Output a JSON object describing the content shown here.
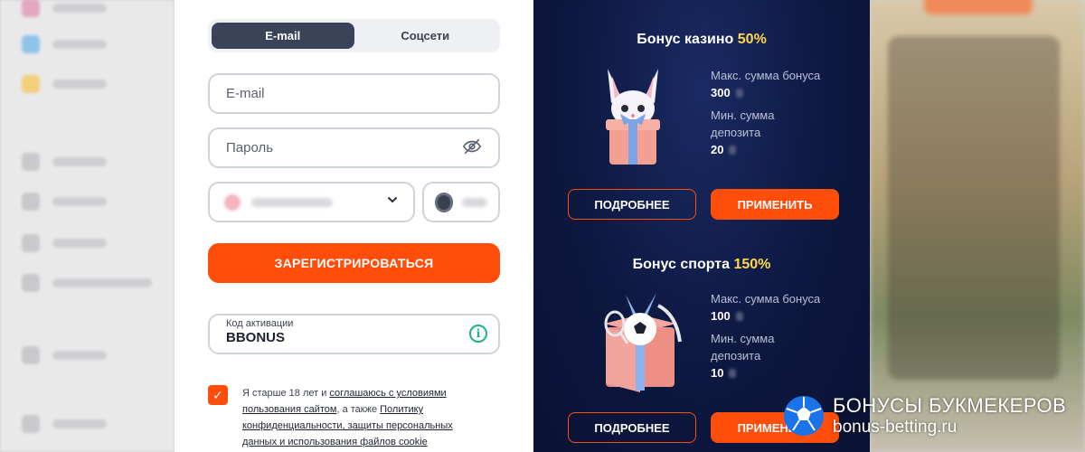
{
  "form": {
    "tabs": [
      {
        "label": "E-mail",
        "active": true
      },
      {
        "label": "Соцсети",
        "active": false
      }
    ],
    "email_placeholder": "E-mail",
    "password_placeholder": "Пароль",
    "register_label": "ЗАРЕГИСТРИРОВАТЬСЯ",
    "promo_label": "Код активации",
    "promo_value": "BBONUS",
    "agree": {
      "t1": "Я старше 18 лет и ",
      "l1": "соглашаюсь с условиями пользования сайтом",
      "t2": ", а также ",
      "l2": "Политику конфиденциальности, защиты персональных данных и использования файлов cookie"
    }
  },
  "casino_bonus": {
    "title": "Бонус казино",
    "percent": "50%",
    "max_label": "Макс. сумма бонуса",
    "max_value": "300",
    "min_label": "Мин. сумма депозита",
    "min_value": "20",
    "more_label": "ПОДРОБНЕЕ",
    "apply_label": "ПРИМЕНИТЬ"
  },
  "sport_bonus": {
    "title": "Бонус спорта",
    "percent": "150%",
    "max_label": "Макс. сумма бонуса",
    "max_value": "100",
    "min_label": "Мин. сумма депозита",
    "min_value": "10",
    "more_label": "ПОДРОБНЕЕ",
    "apply_label": "ПРИМЕНИТЬ"
  },
  "watermark": {
    "line1": "БОНУСЫ БУКМЕКЕРОВ",
    "line2": "bonus-betting.ru"
  },
  "colors": {
    "accent": "#ff4d0b",
    "highlight": "#ffd84d",
    "panel_dark": "#0d1840"
  }
}
